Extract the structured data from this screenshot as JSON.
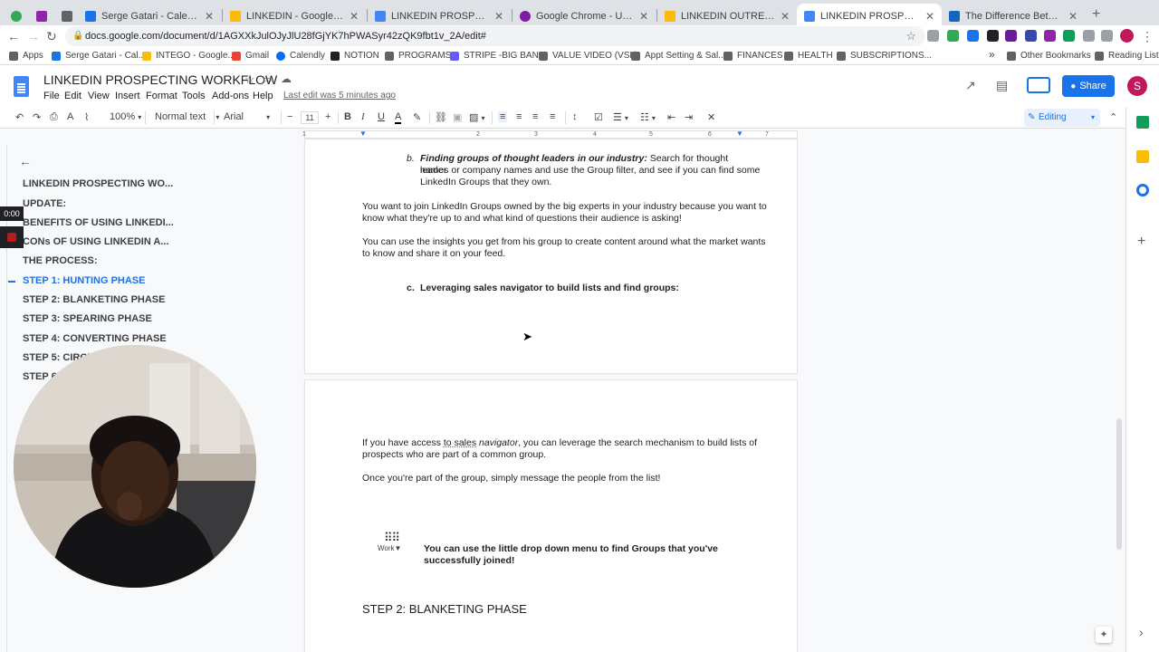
{
  "browser": {
    "tabs": [
      {
        "title": "",
        "color": "#34a853"
      },
      {
        "title": "",
        "color": "#8e24aa"
      },
      {
        "title": "",
        "color": "#5f6368"
      },
      {
        "title": "Serge Gatari - Calendar - Wee",
        "color": "#1a73e8"
      },
      {
        "title": "LINKEDIN - Google Drive",
        "color": "#fbbc04"
      },
      {
        "title": "LINKEDIN PROSPECTING WOR",
        "color": "#4285f4"
      },
      {
        "title": "Google Chrome - Untitled doc",
        "color": "#7b1fa2"
      },
      {
        "title": "LINKEDIN OUTREACH - Googl",
        "color": "#fbbc04"
      },
      {
        "title": "LINKEDIN PROSPECTING WOR",
        "color": "#4285f4"
      },
      {
        "title": "The Difference Between Hunte",
        "color": "#1565c0"
      }
    ],
    "new_tab": "+",
    "url": "docs.google.com/document/d/1AGXXkJulOJyJlU28fGjYK7hPWASyr42zQK9fbt1v_2A/edit#",
    "bookmarks": [
      {
        "label": "Apps",
        "color": "#5f6368"
      },
      {
        "label": "Serge Gatari - Cal...",
        "color": "#1a73e8"
      },
      {
        "label": "INTEGO - Google...",
        "color": "#fbbc04"
      },
      {
        "label": "Gmail",
        "color": "#ea4335"
      },
      {
        "label": "Calendly",
        "color": "#006bff"
      },
      {
        "label": "NOTION",
        "color": "#202124"
      },
      {
        "label": "PROGRAMS",
        "color": "#5f6368"
      },
      {
        "label": "STRIPE -BIG BANK",
        "color": "#635bff"
      },
      {
        "label": "VALUE VIDEO (VSL)",
        "color": "#5f6368"
      },
      {
        "label": "Appt Setting & Sal...",
        "color": "#5f6368"
      },
      {
        "label": "FINANCES",
        "color": "#5f6368"
      },
      {
        "label": "HEALTH",
        "color": "#5f6368"
      },
      {
        "label": "SUBSCRIPTIONS...",
        "color": "#5f6368"
      }
    ],
    "bookmarks_overflow": "»",
    "other_bookmarks": "Other Bookmarks",
    "reading_list": "Reading List"
  },
  "docs": {
    "title": "LINKEDIN PROSPECTING WORKFLOW",
    "menu": [
      "File",
      "Edit",
      "View",
      "Insert",
      "Format",
      "Tools",
      "Add-ons",
      "Help"
    ],
    "last_edit": "Last edit was 5 minutes ago",
    "share_label": "Share",
    "avatar_letter": "S",
    "toolbar": {
      "zoom": "100%",
      "style": "Normal text",
      "font": "Arial",
      "font_size": "11",
      "mode": "Editing"
    },
    "ruler_numbers": [
      "1",
      "1",
      "2",
      "3",
      "4",
      "5",
      "6",
      "7"
    ]
  },
  "outline": {
    "items": [
      {
        "label": "LINKEDIN PROSPECTING WO...",
        "active": false
      },
      {
        "label": "UPDATE:",
        "active": false
      },
      {
        "label": "BENEFITS OF USING LINKEDI...",
        "active": false
      },
      {
        "label": "CONs OF USING LINKEDIN A...",
        "active": false
      },
      {
        "label": "THE PROCESS:",
        "active": false
      },
      {
        "label": "STEP 1: HUNTING PHASE",
        "active": true
      },
      {
        "label": "STEP 2: BLANKETING PHASE",
        "active": false
      },
      {
        "label": "STEP 3: SPEARING PHASE",
        "active": false
      },
      {
        "label": "STEP 4: CONVERTING PHASE",
        "active": false
      },
      {
        "label": "STEP 5: CIRCL",
        "active": false
      },
      {
        "label": "STEP 6",
        "active": false
      }
    ]
  },
  "recorder": {
    "timer": "0:00"
  },
  "page1": {
    "item_b_marker": "b.",
    "item_b_heading": "Finding groups of thought leaders in our industry:",
    "item_b_line1_rest": " Search for thought leader",
    "item_b_line2": "names or company names and use the Group filter, and see if you can find some",
    "item_b_line3": "LinkedIn Groups that they own.",
    "para1_line1": "You want to join LinkedIn Groups owned by the big experts in your industry because you want to",
    "para1_line2": "know what they're up to and what kind of questions their audience is asking!",
    "para2_line1": "You can use the insights you get from his group to create content around what the market wants",
    "para2_line2": "to know and share it on your feed.",
    "item_c_marker": "c.",
    "item_c_heading": "Leveraging sales navigator to build lists and find groups:"
  },
  "page2": {
    "para1_a": "If you have access ",
    "para1_b": "to sales",
    "para1_c": " navigator",
    "para1_d": ", you can leverage the search mechanism to build lists of",
    "para1_line2": "prospects who are part of a common group.",
    "para2": "Once you're part of the group, simply message the people from the list!",
    "work_label": "Work",
    "tip_line1": "You can use the little drop down menu to find Groups that you've",
    "tip_line2": "successfully joined!",
    "heading": "STEP 2: BLANKETING PHASE"
  }
}
